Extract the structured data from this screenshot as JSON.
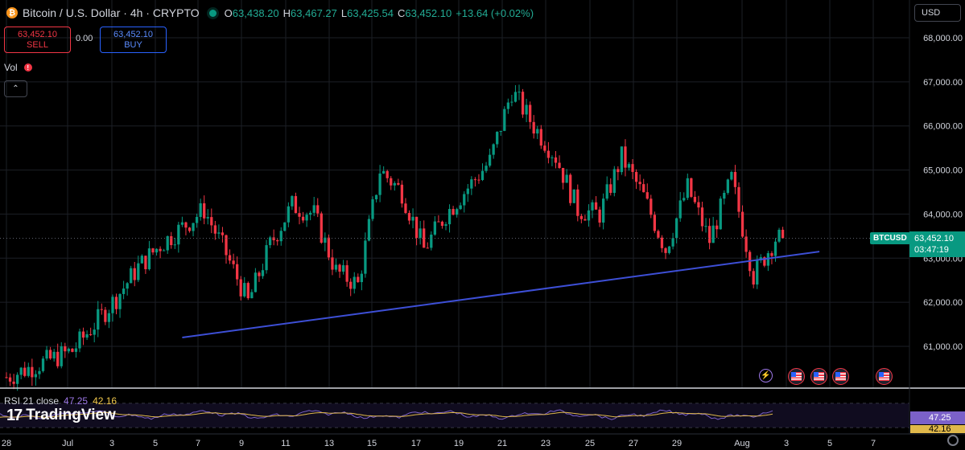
{
  "header": {
    "title": "Bitcoin / U.S. Dollar · 4h · CRYPTO",
    "btc_logo": "₿",
    "ohlc": [
      {
        "key": "O",
        "value": "63,438.20"
      },
      {
        "key": "H",
        "value": "63,467.27"
      },
      {
        "key": "L",
        "value": "63,425.54"
      },
      {
        "key": "C",
        "value": "63,452.10"
      }
    ],
    "change": "+13.64 (+0.02%)",
    "status_color": "#089981"
  },
  "trade": {
    "sell_price": "63,452.10",
    "sell_label": "SELL",
    "spread": "0.00",
    "buy_price": "63,452.10",
    "buy_label": "BUY"
  },
  "indicators": {
    "vol_label": "Vol",
    "warning_glyph": "!",
    "collapse_glyph": "⌃"
  },
  "currency": {
    "selected": "USD"
  },
  "last_price": {
    "symbol": "BTCUSD",
    "price": "63,452.10",
    "countdown": "03:47:19"
  },
  "rsi": {
    "label": "RSI 21 close",
    "value_a": "47.25",
    "value_b": "42.16",
    "tag_a": "47.25",
    "tag_b": "42.16"
  },
  "branding": {
    "logo_mark": "17",
    "logo_text": "TradingView"
  },
  "colors": {
    "up": "#089981",
    "down": "#f23645",
    "trendline": "#3d4fd6",
    "rsi_line": "#7b61c9",
    "rsi_ma": "#e0b84a",
    "grid": "#1c1f26",
    "axis_text": "#d1d4dc"
  },
  "events": {
    "bolt_icon": "lightning-icon",
    "flag_icon": "us-flag-icon",
    "count": 4
  },
  "chart_data": {
    "type": "candlestick",
    "title": "Bitcoin / U.S. Dollar · 4h · CRYPTO",
    "y_ticks": [
      61000,
      62000,
      63000,
      64000,
      65000,
      66000,
      67000,
      68000
    ],
    "y_tick_labels": [
      "61,000.00",
      "62,000.00",
      "63,000.00",
      "64,000.00",
      "65,000.00",
      "66,000.00",
      "67,000.00",
      "68,000.00"
    ],
    "ylim": [
      60300,
      68500
    ],
    "x_tick_labels": [
      "28",
      "Jul",
      "3",
      "5",
      "7",
      "9",
      "11",
      "13",
      "15",
      "17",
      "19",
      "21",
      "23",
      "25",
      "27",
      "29",
      "Aug",
      "3",
      "5",
      "7"
    ],
    "close_anchors": [
      {
        "x": "Jun 28",
        "y": 60300
      },
      {
        "x": "Jul 1",
        "y": 60900
      },
      {
        "x": "Jul 2",
        "y": 61500
      },
      {
        "x": "Jul 3",
        "y": 62100
      },
      {
        "x": "Jul 4",
        "y": 62800
      },
      {
        "x": "Jul 5",
        "y": 63300
      },
      {
        "x": "Jul 6",
        "y": 63700
      },
      {
        "x": "Jul 7",
        "y": 64100
      },
      {
        "x": "Jul 8",
        "y": 63100
      },
      {
        "x": "Jul 9",
        "y": 62000
      },
      {
        "x": "Jul 10",
        "y": 63300
      },
      {
        "x": "Jul 11",
        "y": 64200
      },
      {
        "x": "Jul 12",
        "y": 64000
      },
      {
        "x": "Jul 13",
        "y": 62700
      },
      {
        "x": "Jul 14",
        "y": 62400
      },
      {
        "x": "Jul 15",
        "y": 65000
      },
      {
        "x": "Jul 16",
        "y": 64500
      },
      {
        "x": "Jul 17",
        "y": 63200
      },
      {
        "x": "Jul 18",
        "y": 64000
      },
      {
        "x": "Jul 19",
        "y": 64600
      },
      {
        "x": "Jul 20",
        "y": 65200
      },
      {
        "x": "Jul 21",
        "y": 66800
      },
      {
        "x": "Jul 22",
        "y": 66000
      },
      {
        "x": "Jul 23",
        "y": 65300
      },
      {
        "x": "Jul 24",
        "y": 64100
      },
      {
        "x": "Jul 25",
        "y": 64000
      },
      {
        "x": "Jul 26",
        "y": 65300
      },
      {
        "x": "Jul 27",
        "y": 64400
      },
      {
        "x": "Jul 28",
        "y": 63200
      },
      {
        "x": "Jul 29",
        "y": 64600
      },
      {
        "x": "Jul 30",
        "y": 63400
      },
      {
        "x": "Jul 31",
        "y": 64800
      },
      {
        "x": "Aug 1",
        "y": 62600
      },
      {
        "x": "Aug 2",
        "y": 63450
      }
    ],
    "last_price": 63452.1,
    "trendline": [
      {
        "x": "Jul 6",
        "y": 61200
      },
      {
        "x": "Aug 4",
        "y": 63150
      }
    ],
    "rsi": {
      "name": "RSI 21 close",
      "last": 47.25,
      "ma_last": 42.16
    },
    "grid": true
  }
}
